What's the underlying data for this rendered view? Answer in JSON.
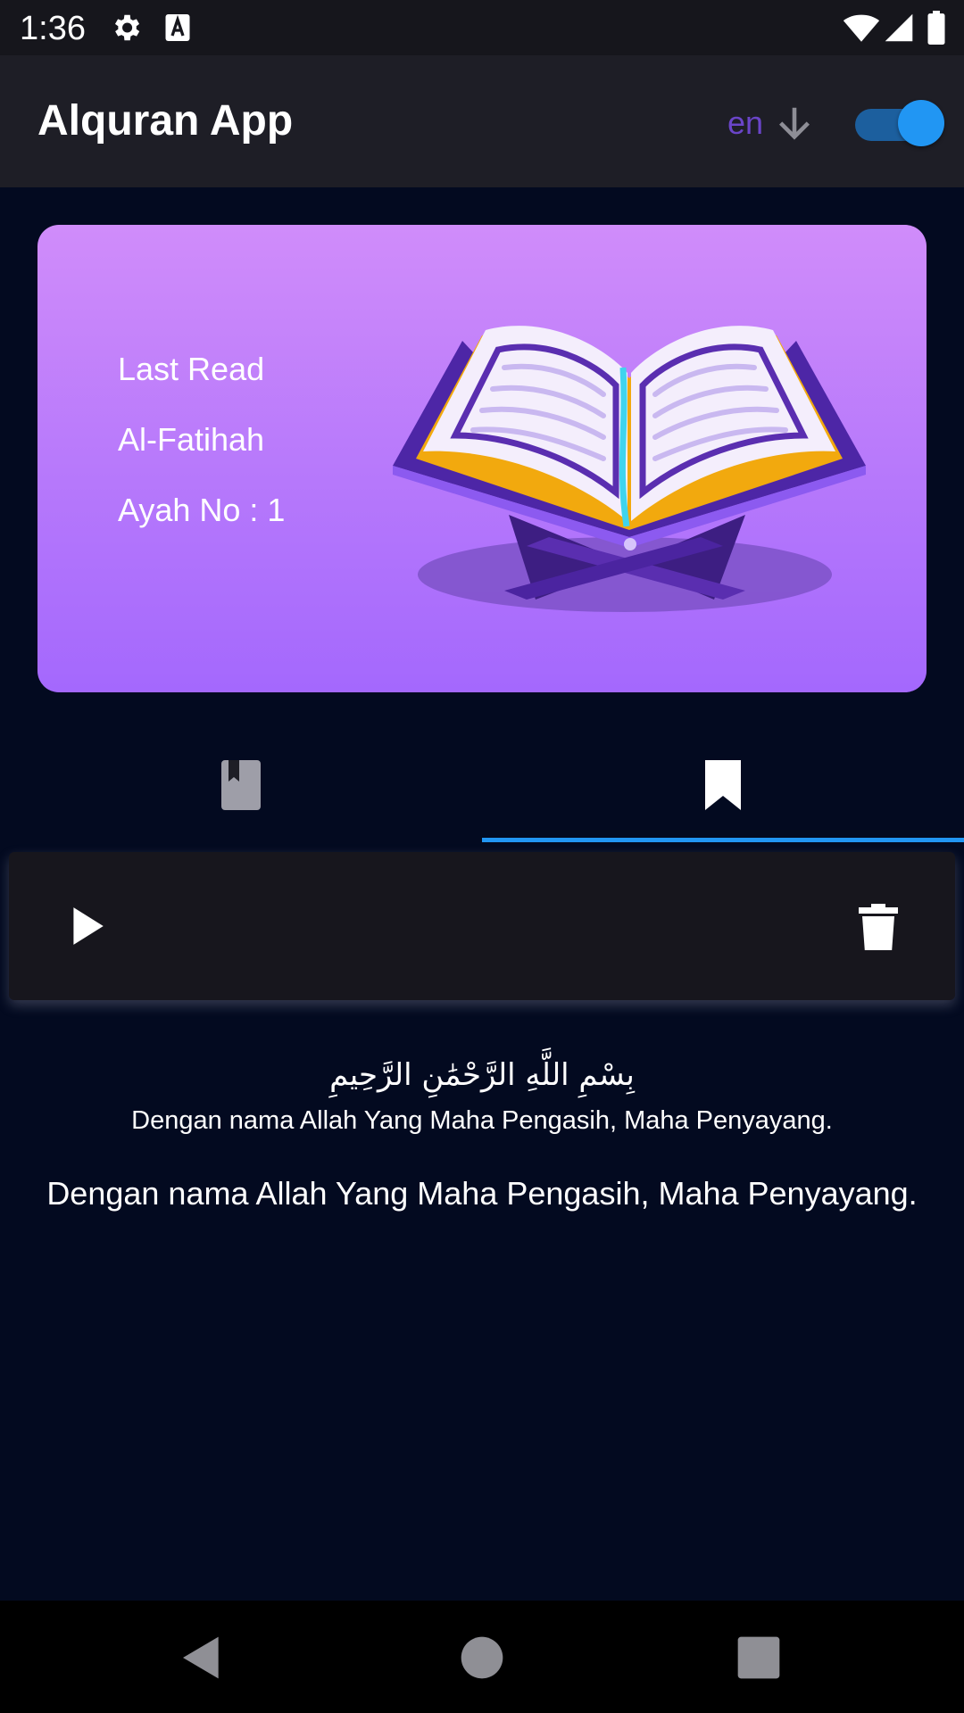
{
  "status_bar": {
    "time": "1:36",
    "icons": [
      "settings-icon",
      "text-a-icon",
      "wifi-icon",
      "signal-icon",
      "battery-icon"
    ]
  },
  "app_bar": {
    "title": "Alquran App",
    "language": "en",
    "dark_mode_toggle": true
  },
  "last_read": {
    "label": "Last Read",
    "surah": "Al-Fatihah",
    "ayah": "Ayah No : 1"
  },
  "tabs": [
    {
      "icon": "book-icon",
      "selected": false
    },
    {
      "icon": "bookmark-icon",
      "selected": true
    }
  ],
  "audio_bar": {
    "play_icon": "play-icon",
    "delete_icon": "delete-icon"
  },
  "ayah": {
    "arabic": "بِسْمِ اللَّهِ الرَّحْمَٰنِ الرَّحِيمِ",
    "translation": "Dengan nama Allah Yang Maha Pengasih, Maha Penyayang.",
    "translation_secondary": "Dengan nama Allah Yang Maha Pengasih, Maha Penyayang."
  },
  "nav_bar": {
    "buttons": [
      "back-icon",
      "home-icon",
      "recents-icon"
    ]
  },
  "colors": {
    "background": "#030a20",
    "app_bar": "#1e1e26",
    "accent": "#2196f3",
    "language_text": "#6a45c8",
    "card_top": "#d08cfa",
    "card_bottom": "#a468fd"
  }
}
